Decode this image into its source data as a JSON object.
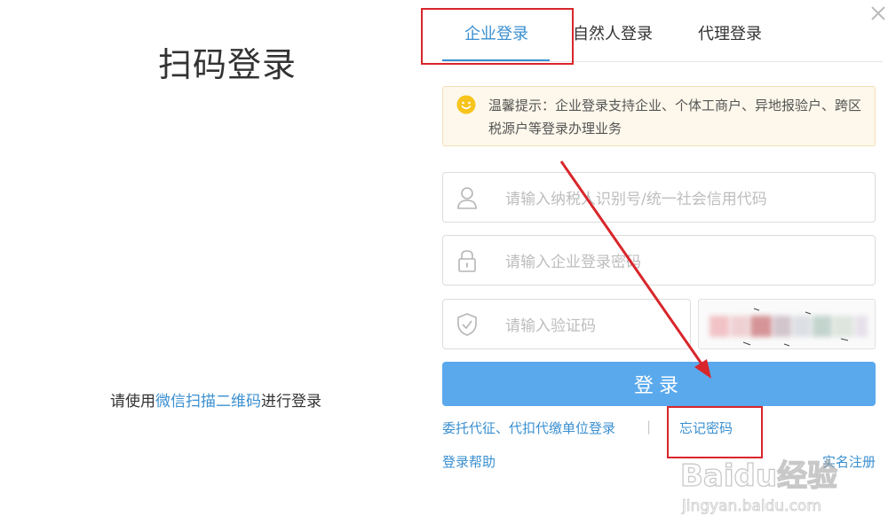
{
  "qr_login": {
    "title": "扫码登录",
    "hint_prefix": "请使用",
    "hint_link": "微信扫描二维码",
    "hint_suffix": "进行登录"
  },
  "close_icon": "close-icon",
  "tabs": [
    {
      "label": "企业登录",
      "active": true
    },
    {
      "label": "自然人登录",
      "active": false
    },
    {
      "label": "代理登录",
      "active": false
    }
  ],
  "notice": {
    "icon": "smile-icon",
    "text": "温馨提示：企业登录支持企业、个体工商户、异地报验户、跨区税源户等登录办理业务"
  },
  "form": {
    "taxid_placeholder": "请输入纳税人识别号/统一社会信用代码",
    "password_placeholder": "请输入企业登录密码",
    "captcha_placeholder": "请输入验证码",
    "login_label": "登录"
  },
  "links": {
    "delegate": "委托代征、代扣代缴单位登录",
    "separator": "|",
    "forgot_password": "忘记密码",
    "help": "登录帮助",
    "register": "实名注册"
  },
  "watermark": {
    "brand": "Baidu经验",
    "url": "jingyan.baidu.com"
  },
  "colors": {
    "accent": "#3a8fd0",
    "button": "#5aa9ec",
    "annotation": "#d8262b",
    "notice_bg": "#fdf8eb"
  }
}
